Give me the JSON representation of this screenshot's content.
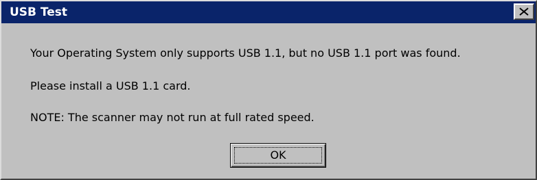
{
  "window": {
    "title": "USB Test",
    "close_icon": "close-icon"
  },
  "message": {
    "line1": "Your Operating System only supports USB 1.1, but no USB 1.1 port was found.",
    "line2": "Please install a USB 1.1 card.",
    "line3": "NOTE: The scanner may not run at full rated speed."
  },
  "buttons": {
    "ok_label": "OK"
  },
  "colors": {
    "titlebar": "#0a246a",
    "title_text": "#ffffff",
    "dialog_background": "#c0c0c0",
    "text": "#000000"
  }
}
